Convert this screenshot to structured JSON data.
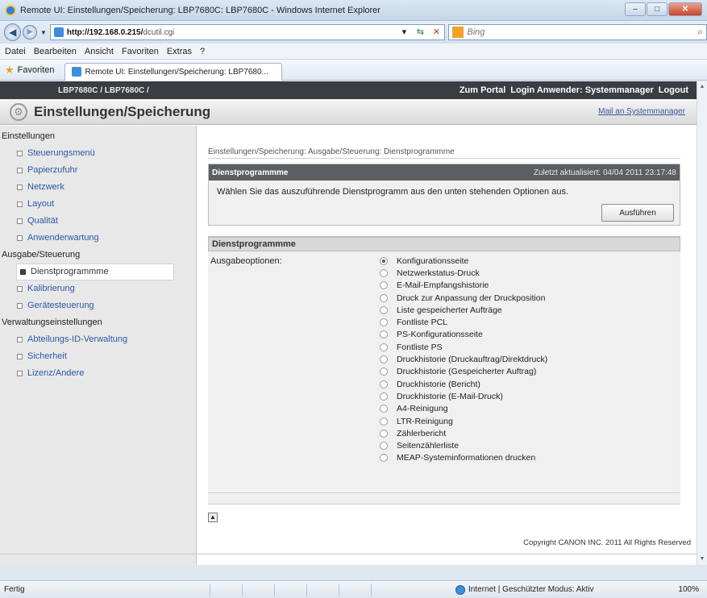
{
  "window": {
    "title": "Remote UI: Einstellungen/Speicherung: LBP7680C: LBP7680C - Windows Internet Explorer",
    "minimize": "–",
    "maximize": "□",
    "close": "✕"
  },
  "address": {
    "url_host": "http://192.168.0.215/",
    "url_path": "dcutil.cgi",
    "search_placeholder": "Bing"
  },
  "menu": [
    "Datei",
    "Bearbeiten",
    "Ansicht",
    "Favoriten",
    "Extras",
    "?"
  ],
  "favorites": {
    "label": "Favoriten",
    "tab_title": "Remote UI: Einstellungen/Speicherung: LBP7680..."
  },
  "page": {
    "device": "LBP7680C / LBP7680C /",
    "portal_link": "Zum Portal",
    "login_text": "Login Anwender: Systemmanager",
    "logout_link": "Logout",
    "app_title": "Einstellungen/Speicherung",
    "mail_link": "Mail an Systemmanager"
  },
  "sidebar": {
    "sections": [
      {
        "label": "Einstellungen",
        "items": [
          "Steuerungsmenü",
          "Papierzufuhr",
          "Netzwerk",
          "Layout",
          "Qualität",
          "Anwenderwartung"
        ]
      },
      {
        "label": "Ausgabe/Steuerung",
        "items": [
          "Dienstprogrammme",
          "Kalibrierung",
          "Gerätesteuerung"
        ]
      },
      {
        "label": "Verwaltungseinstellungen",
        "items": [
          "Abteilungs-ID-Verwaltung",
          "Sicherheit",
          "Lizenz/Andere"
        ]
      }
    ],
    "active": "Dienstprogrammme"
  },
  "main": {
    "breadcrumb": "Einstellungen/Speicherung: Ausgabe/Steuerung: Dienstprogrammme",
    "panel1_title": "Dienstprogrammme",
    "last_updated": "Zuletzt aktualisiert: 04/04 2011 23:17:48",
    "instruction": "Wählen Sie das auszuführende Dienstprogramm aus den unten stehenden Optionen aus.",
    "execute_button": "Ausführen",
    "panel2_title": "Dienstprogrammme",
    "output_label": "Ausgabeoptionen:",
    "options": [
      "Konfigurationsseite",
      "Netzwerkstatus-Druck",
      "E-Mail-Empfangshistorie",
      "Druck zur Anpassung der Druckposition",
      "Liste gespeicherter Aufträge",
      "Fontliste PCL",
      "PS-Konfigurationsseite",
      "Fontliste PS",
      "Druckhistorie (Druckauftrag/Direktdruck)",
      "Druckhistorie (Gespeicherter Auftrag)",
      "Druckhistorie (Bericht)",
      "Druckhistorie (E-Mail-Druck)",
      "A4-Reinigung",
      "LTR-Reinigung",
      "Zählerbericht",
      "Seitenzählerliste",
      "MEAP-Systeminformationen drucken"
    ],
    "selected_option": "Konfigurationsseite",
    "copyright": "Copyright CANON INC. 2011 All Rights Reserved"
  },
  "status": {
    "text": "Fertig",
    "zone": "Internet | Geschützter Modus: Aktiv",
    "zoom": "100%"
  }
}
